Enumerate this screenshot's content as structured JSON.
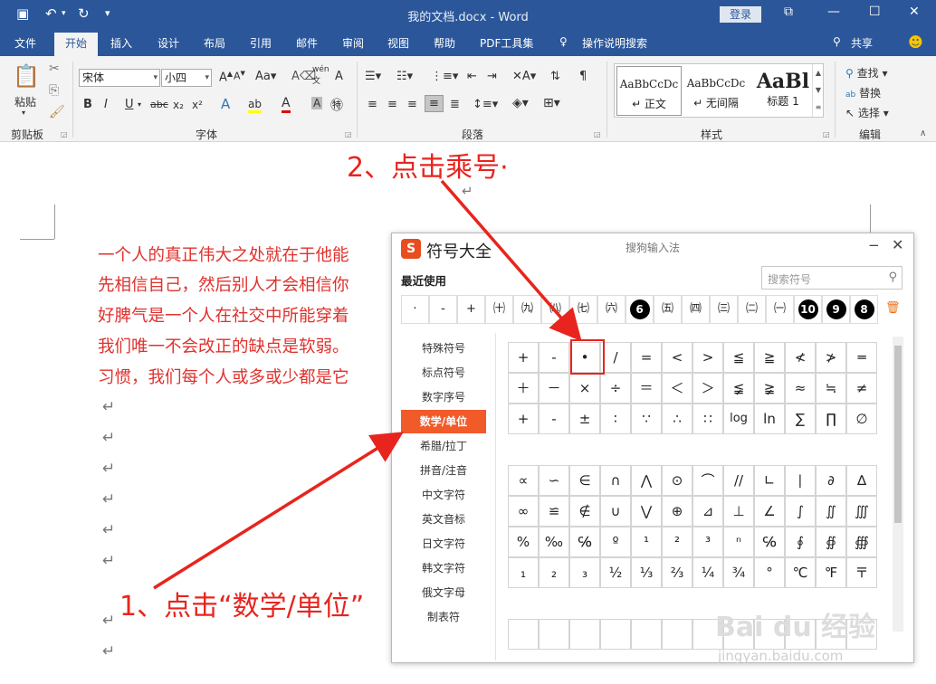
{
  "titlebar": {
    "title": "我的文档.docx  -  Word",
    "login": "登录",
    "save_icon": "save-icon",
    "undo_icon": "undo-icon",
    "redo_icon": "redo-icon"
  },
  "tabs": [
    "文件",
    "开始",
    "插入",
    "设计",
    "布局",
    "引用",
    "邮件",
    "审阅",
    "视图",
    "帮助",
    "PDF工具集",
    "操作说明搜索"
  ],
  "tab_active": "开始",
  "share": "共享",
  "ribbon": {
    "clipboard": {
      "label": "剪贴板",
      "paste": "粘贴"
    },
    "font": {
      "label": "字体",
      "font_name": "宋体",
      "font_size": "小四",
      "aa": "Aa",
      "wen": "wén"
    },
    "paragraph": {
      "label": "段落"
    },
    "styles": {
      "label": "样式",
      "items": [
        {
          "preview": "AaBbCcDc",
          "name": "↵ 正文"
        },
        {
          "preview": "AaBbCcDc",
          "name": "↵ 无间隔"
        },
        {
          "preview": "AaBl",
          "name": "标题 1"
        }
      ]
    },
    "editing": {
      "label": "编辑",
      "find": "查找",
      "replace": "替换",
      "select": "选择"
    }
  },
  "document": {
    "lines": [
      "一个人的真正伟大之处就在于他能",
      "先相信自己，然后别人才会相信你",
      "好脾气是一个人在社交中所能穿着",
      "我们唯一不会改正的缺点是软弱。",
      "习惯，我们每个人或多或少都是它"
    ],
    "paragraph_mark": "↵"
  },
  "annotations": {
    "step1": "1、点击“数学/单位”",
    "step2": "2、点击乘号·"
  },
  "dialog": {
    "title": "符号大全",
    "subtitle": "搜狗输入法",
    "logo": "S",
    "minimize": "−",
    "close": "✕",
    "recent_label": "最近使用",
    "search_placeholder": "搜索符号",
    "recent": [
      "·",
      "-",
      "+",
      "㈩",
      "㈨",
      "㈧",
      "㈦",
      "㈥",
      "6",
      "㈤",
      "㈣",
      "㈢",
      "㈡",
      "㈠",
      "10",
      "9",
      "8"
    ],
    "categories": [
      "特殊符号",
      "标点符号",
      "数字序号",
      "数学/单位",
      "希腊/拉丁",
      "拼音/注音",
      "中文字符",
      "英文音标",
      "日文字符",
      "韩文字符",
      "俄文字母",
      "制表符"
    ],
    "active_category": "数学/单位",
    "symbols_block1": [
      [
        "+",
        "-",
        "•",
        "/",
        "=",
        "<",
        ">",
        "≦",
        "≧",
        "≮",
        "≯",
        "═"
      ],
      [
        "＋",
        "－",
        "×",
        "÷",
        "＝",
        "＜",
        "＞",
        "≨",
        "≩",
        "≈",
        "≒",
        "≠"
      ],
      [
        "+",
        "-",
        "±",
        "∶",
        "∵",
        "∴",
        "∷",
        "log",
        "ln",
        "∑",
        "∏",
        "∅"
      ]
    ],
    "symbols_block2": [
      [
        "∝",
        "∽",
        "∈",
        "∩",
        "⋀",
        "⊙",
        "⌒",
        "//",
        "∟",
        "∣",
        "∂",
        "∆"
      ],
      [
        "∞",
        "≌",
        "∉",
        "∪",
        "⋁",
        "⊕",
        "⊿",
        "⊥",
        "∠",
        "∫",
        "∬",
        "∭"
      ],
      [
        "%",
        "‰",
        "℅",
        "º",
        "¹",
        "²",
        "³",
        "ⁿ",
        "℅",
        "∮",
        "∯",
        "∰"
      ],
      [
        "₁",
        "₂",
        "₃",
        "½",
        "⅓",
        "⅔",
        "¼",
        "¾",
        "°",
        "℃",
        "℉",
        "〒"
      ]
    ]
  },
  "watermark": {
    "main": "Bai du 经验",
    "sub": "jingyan.baidu.com"
  },
  "colors": {
    "titlebar": "#2b579a",
    "annotation": "#e8241e",
    "doc_text": "#e0312d",
    "active_category": "#f15a29"
  }
}
